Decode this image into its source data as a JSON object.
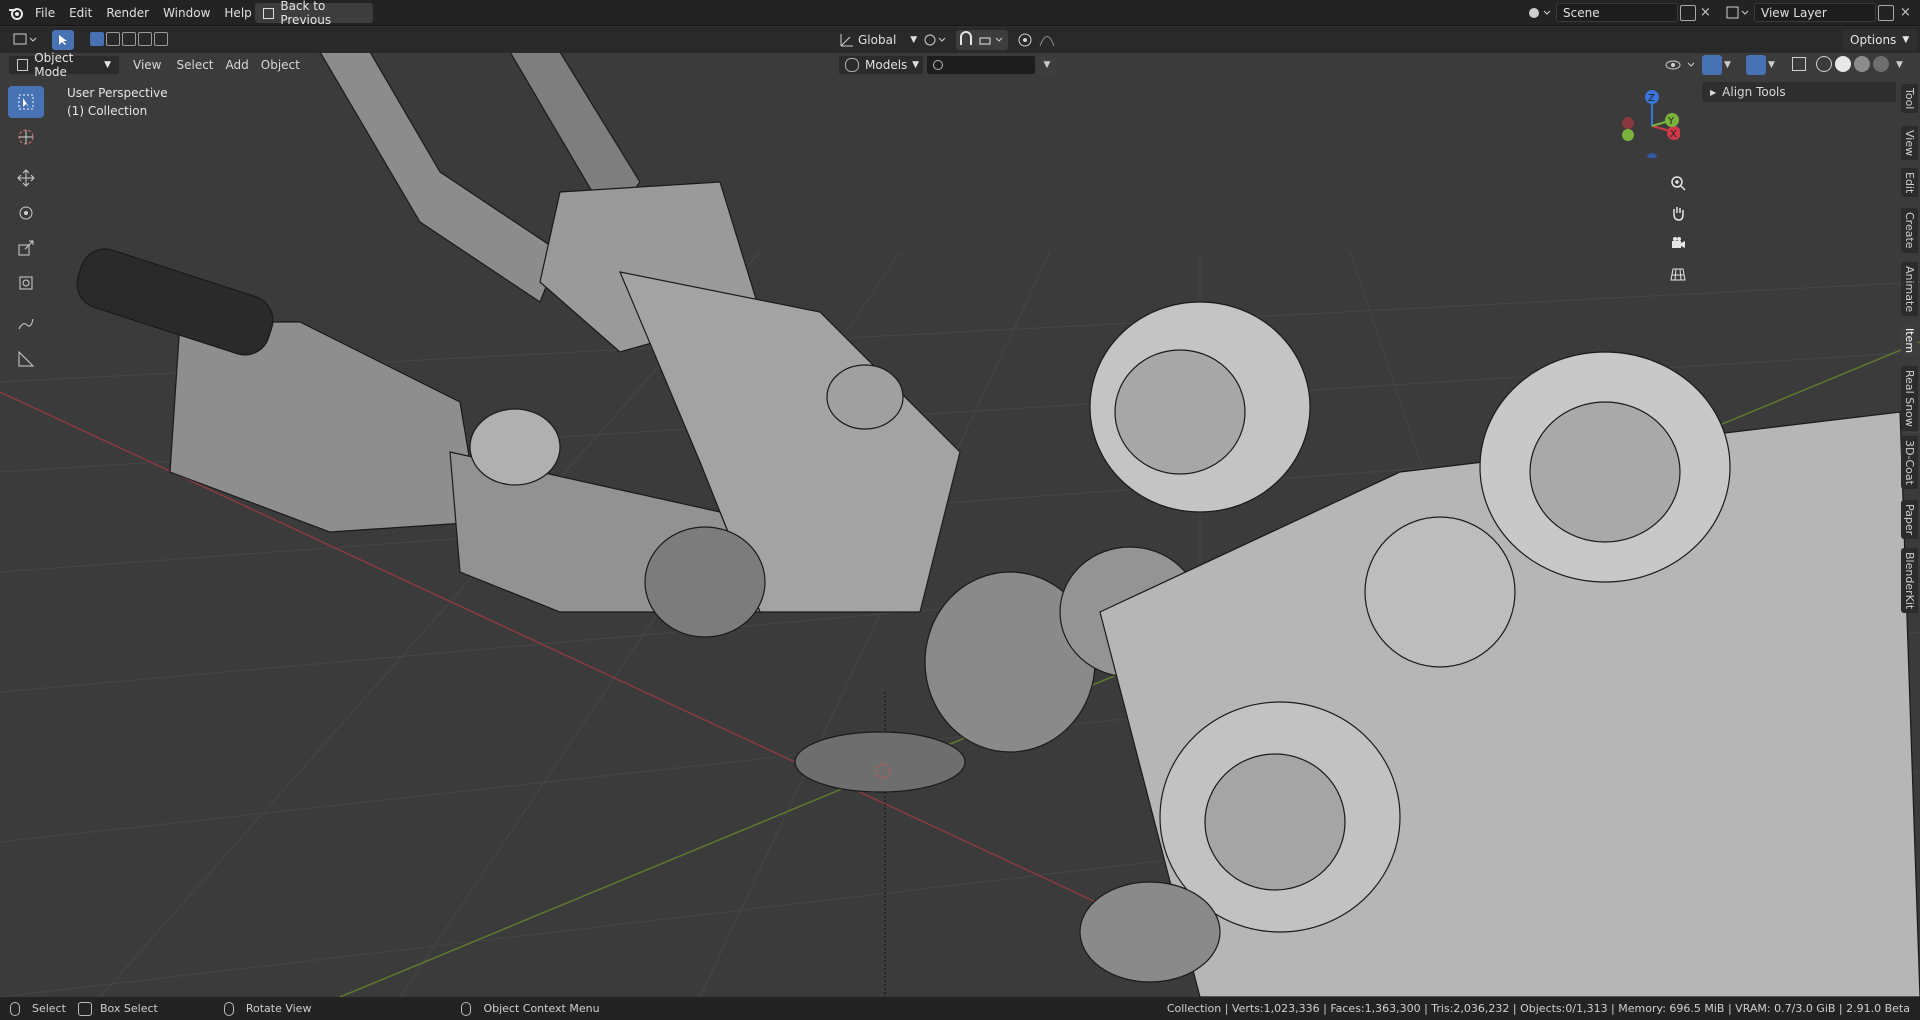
{
  "menu": {
    "items": [
      "File",
      "Edit",
      "Render",
      "Window",
      "Help"
    ],
    "back_button": "Back to Previous"
  },
  "topright": {
    "scene_label": "Scene",
    "view_layer_label": "View Layer"
  },
  "header": {
    "mode": "Object Mode",
    "view": "View",
    "select": "Select",
    "add": "Add",
    "object": "Object",
    "orientation": "Global",
    "options": "Options",
    "collection_dropdown": "Models",
    "search_placeholder": ""
  },
  "viewport": {
    "perspective": "User Perspective",
    "collection": "(1) Collection"
  },
  "sidebar_panel": {
    "title": "Align Tools"
  },
  "side_tabs": [
    "Tool",
    "View",
    "Edit",
    "Create",
    "Animate",
    "Item",
    "Real Snow",
    "3D-Coat",
    "Paper",
    "BlenderKit"
  ],
  "gizmo": {
    "x": "X",
    "y": "Y",
    "z": "Z"
  },
  "status": {
    "select": "Select",
    "box_select": "Box Select",
    "rotate_view": "Rotate View",
    "context_menu": "Object Context Menu",
    "stats": "Collection | Verts:1,023,336 | Faces:1,363,300 | Tris:2,036,232 | Objects:0/1,313 | Memory: 696.5 MiB | VRAM: 0.7/3.0 GiB | 2.91.0 Beta"
  },
  "colors": {
    "accent": "#4772b3",
    "x_axis": "#d0394a",
    "y_axis": "#7ab33a",
    "z_axis": "#3b74d9"
  }
}
